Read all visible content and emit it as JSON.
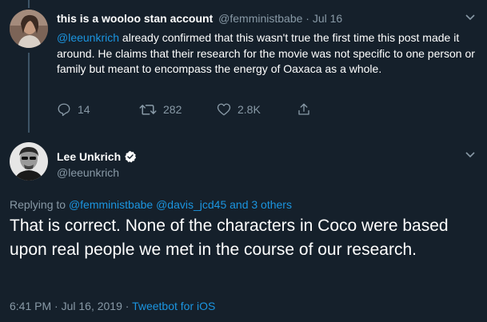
{
  "tweet1": {
    "display_name": "this is a wooloo stan account",
    "handle": "@femministbabe",
    "separator": " · ",
    "date": "Jul 16",
    "mention": "@leeunkrich",
    "text": " already confirmed that this wasn't true the first time this post made it around. He claims that their research for the movie was not specific to one person or family but meant to encompass the energy of Oaxaca as a whole.",
    "actions": {
      "reply_count": "14",
      "retweet_count": "282",
      "like_count": "2.8K"
    }
  },
  "tweet2": {
    "display_name": "Lee Unkrich",
    "handle": "@leeunkrich",
    "verified": true,
    "replying_prefix": "Replying to ",
    "replying_to": "@femministbabe @davis_jcd45 and 3 others",
    "text": "That is correct. None of the characters in Coco were based upon real people we met in the course of our research.",
    "timestamp": "6:41 PM · Jul 16, 2019 · ",
    "client": "Tweetbot for iOS"
  },
  "icons": {
    "reply": "reply-icon",
    "retweet": "retweet-icon",
    "like": "heart-icon",
    "share": "share-icon",
    "chevron": "chevron-down-icon",
    "verified": "verified-badge-icon"
  },
  "colors": {
    "background": "#15202b",
    "text": "#ffffff",
    "muted": "#8899a6",
    "link": "#1b95e0",
    "thread_line": "#3d5466"
  }
}
